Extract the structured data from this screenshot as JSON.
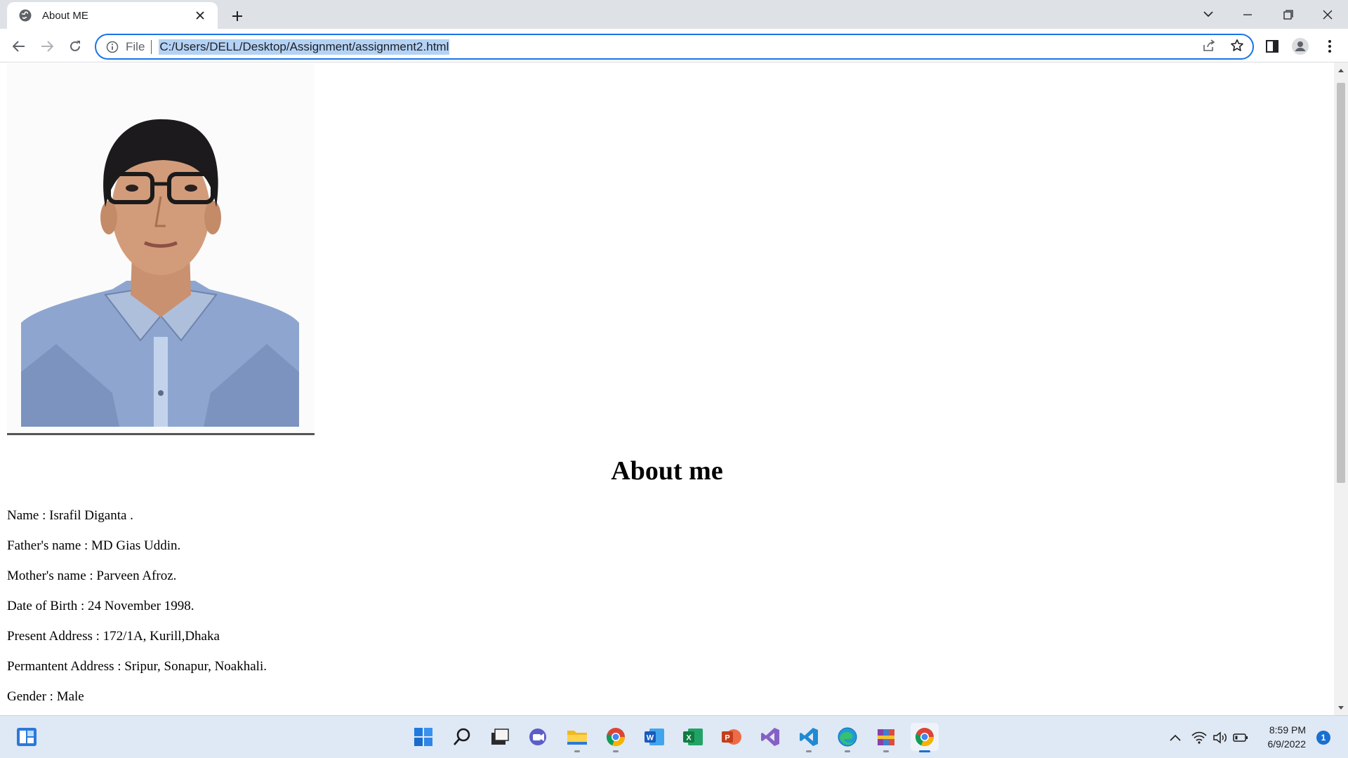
{
  "browser": {
    "tab": {
      "title": "About ME",
      "favicon": "globe-icon"
    },
    "omnibox": {
      "scheme": "File",
      "url": "C:/Users/DELL/Desktop/Assignment/assignment2.html"
    }
  },
  "page": {
    "photo": {
      "alt": "profile-photo"
    },
    "heading": "About me",
    "details": [
      "Name : Israfil Diganta .",
      "Father's name : MD Gias Uddin.",
      "Mother's name : Parveen Afroz.",
      "Date of Birth : 24 November 1998.",
      "Present Address : 172/1A, Kurill,Dhaka",
      "Permantent Address : Sripur, Sonapur, Noakhali.",
      "Gender : Male"
    ]
  },
  "taskbar": {
    "apps": [
      "start-icon",
      "search-icon",
      "task-view-icon",
      "teams-icon",
      "file-explorer-icon",
      "chrome-icon",
      "word-icon",
      "excel-icon",
      "powerpoint-icon",
      "visual-studio-icon",
      "vscode-icon",
      "edge-icon",
      "winrar-icon",
      "chrome-icon"
    ],
    "clock_time": "8:59 PM",
    "clock_date": "6/9/2022",
    "notification_count": "1"
  },
  "colors": {
    "accent": "#1a73e8",
    "selection": "#b4d2f5",
    "tabstrip": "#dee1e6",
    "taskbar": "#dfe8f5"
  }
}
